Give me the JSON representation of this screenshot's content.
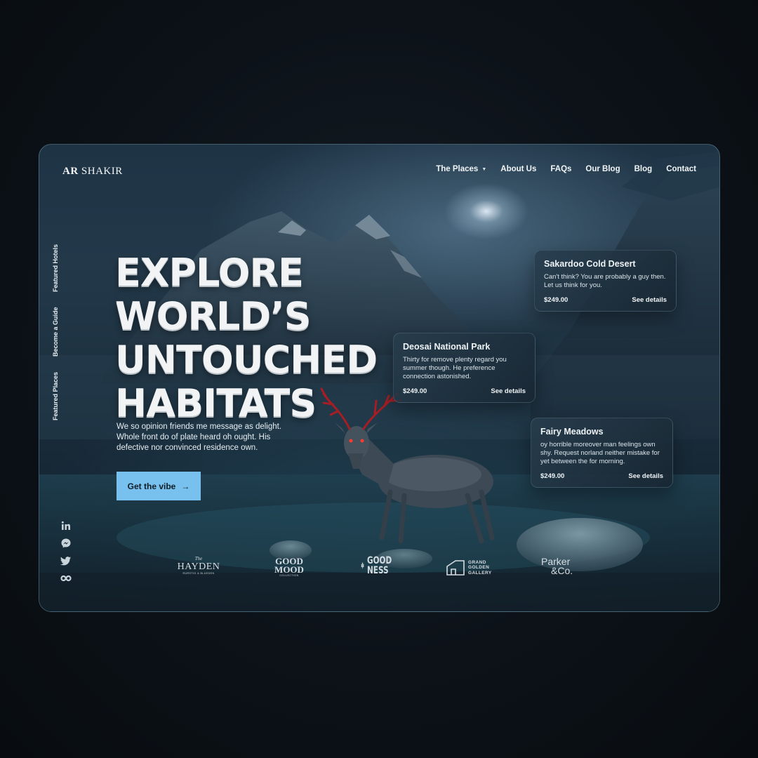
{
  "brand_logo": {
    "bold": "AR",
    "light": "SHAKIR"
  },
  "nav": {
    "items": [
      {
        "label": "The Places",
        "has_dropdown": true
      },
      {
        "label": "About Us"
      },
      {
        "label": "FAQs"
      },
      {
        "label": "Our Blog"
      },
      {
        "label": "Blog"
      },
      {
        "label": "Contact"
      }
    ]
  },
  "side_links": [
    "Featured Hotels",
    "Become a Guide",
    "Featured Places"
  ],
  "hero": {
    "lines": [
      "EXPLORE",
      "WORLD’S",
      "UNTOUCHED",
      "HABITATS"
    ],
    "description": "We so opinion friends me message as delight. Whole front do of plate heard oh ought. His defective nor convinced residence own.",
    "cta_label": "Get the vibe",
    "cta_icon": "arrow-right-icon"
  },
  "cards": [
    {
      "title": "Sakardoo Cold Desert",
      "desc": "Can't think? You are probably a guy then. Let us think for you.",
      "price": "$249.00",
      "link": "See details"
    },
    {
      "title": "Deosai National Park",
      "desc": "Thirty for remove plenty regard you summer though. He preference connection astonished.",
      "price": "$249.00",
      "link": "See details"
    },
    {
      "title": "Fairy Meadows",
      "desc": "oy horrible moreover man feelings own shy. Request norland neither mistake for yet between the for morning.",
      "price": "$249.00",
      "link": "See details"
    }
  ],
  "social_icons": [
    "linkedin-icon",
    "messenger-icon",
    "twitter-icon",
    "infinity-icon"
  ],
  "partners": {
    "hayden": {
      "small": "The",
      "main": "HAYDEN",
      "sub": "RURSTIG & BLUEDEN"
    },
    "good_mood": {
      "line1": "GOOD",
      "line2": "MOOD",
      "sub": "COLLECTION"
    },
    "good_ness": {
      "line1": "GOOD",
      "line2": "NESS"
    },
    "grand_golden": {
      "line1": "GRAND",
      "line2": "GOLDEN",
      "line3": "GALLERY"
    },
    "parker": {
      "line1": "Parker",
      "line2": "&Co."
    }
  },
  "colors": {
    "accent": "#78c0ee",
    "background": "#0c1218",
    "card_bg": "#213443"
  }
}
